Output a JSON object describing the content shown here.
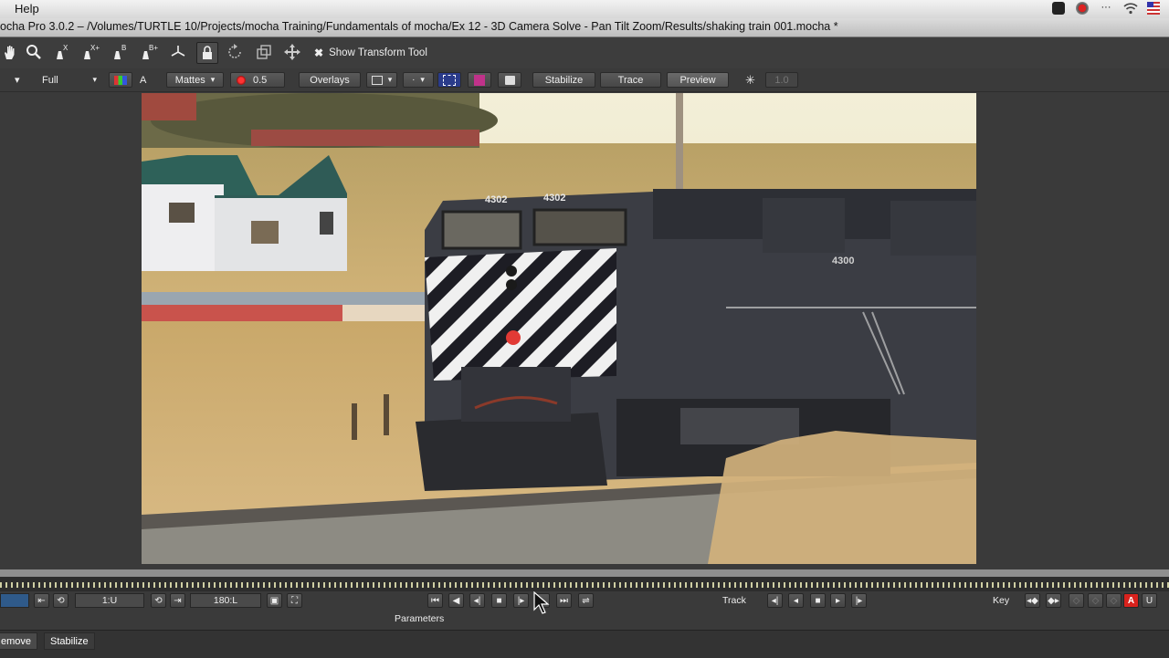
{
  "menubar": {
    "help": "Help",
    "flag": "US"
  },
  "window": {
    "title": "ocha Pro 3.0.2 – /Volumes/TURTLE 10/Projects/mocha Training/Fundamentals of mocha/Ex 12 - 3D Camera Solve - Pan Tilt Zoom/Results/shaking train 001.mocha *"
  },
  "toolbar": {
    "show_transform_label": "Show Transform Tool",
    "show_transform_mark": "✖"
  },
  "options": {
    "resolution": "Full",
    "alpha_label": "A",
    "mattes": "Mattes",
    "opacity": "0.5",
    "overlays": "Overlays",
    "stabilize": "Stabilize",
    "trace": "Trace",
    "preview": "Preview",
    "sun_value": "1.0"
  },
  "transport": {
    "in_point": "1:U",
    "out_point": "180:L",
    "track_label": "Track",
    "key_label": "Key",
    "parameters_label": "Parameters"
  },
  "bottom_tabs": [
    "emove",
    "Stabilize"
  ],
  "frame_text": {
    "loco_number_1": "4302",
    "loco_number_2": "4302",
    "loco_number_3": "4300"
  }
}
